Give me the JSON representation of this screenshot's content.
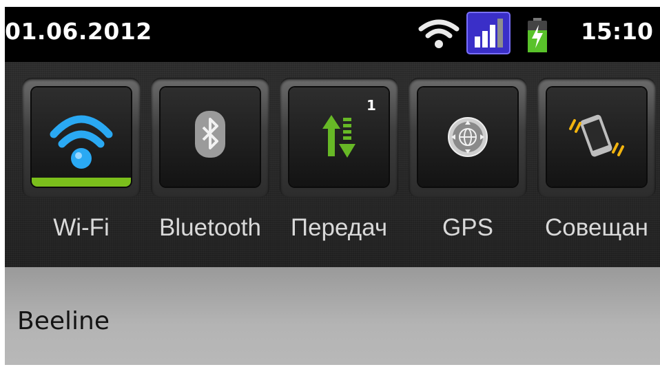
{
  "status_bar": {
    "date": "01.06.2012",
    "time": "15:10",
    "icons": [
      "wifi-icon",
      "signal-strength-icon",
      "battery-charging-icon"
    ]
  },
  "quick_settings": {
    "toggles": [
      {
        "label": "Wi-Fi",
        "icon": "wifi-icon",
        "active": true
      },
      {
        "label": "Bluetooth",
        "icon": "bluetooth-icon",
        "active": false
      },
      {
        "label": "Передач",
        "icon": "data-transfer-icon",
        "active": false,
        "badge": "1"
      },
      {
        "label": "GPS",
        "icon": "gps-icon",
        "active": false
      },
      {
        "label": "Совещан",
        "icon": "vibrate-phone-icon",
        "active": false
      }
    ]
  },
  "operator": {
    "name": "Beeline"
  },
  "colors": {
    "accent_active": "#7bbf1c",
    "wifi_blue": "#2aa9f3",
    "signal_tile": "#3a2fc8",
    "battery_green": "#59c22a"
  }
}
